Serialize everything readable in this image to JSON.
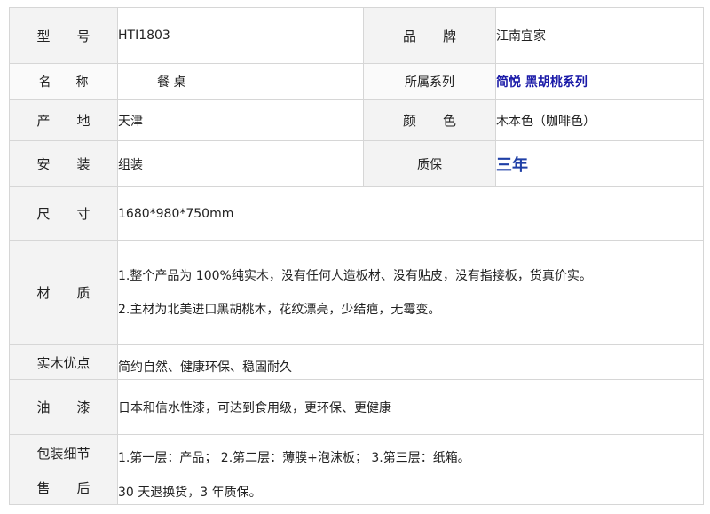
{
  "rows": {
    "model": {
      "label": "型　　号",
      "value": "HTI1803"
    },
    "brand": {
      "label": "品　　牌",
      "value": "江南宜家"
    },
    "name": {
      "label": "名　　称",
      "value": "餐 桌"
    },
    "series": {
      "label": "所属系列",
      "value": "简悦 黑胡桃系列"
    },
    "origin": {
      "label": "产　　地",
      "value": "天津"
    },
    "color": {
      "label": "颜　　色",
      "value": "木本色（咖啡色）"
    },
    "install": {
      "label": "安　　装",
      "value": "组装"
    },
    "warranty": {
      "label": "质保",
      "value": "三年"
    },
    "size": {
      "label": "尺　　寸",
      "value": "1680*980*750mm"
    },
    "material": {
      "label": "材　　质",
      "lines": [
        "1.整个产品为 100%纯实木，没有任何人造板材、没有贴皮，没有指接板，货真价实。",
        "2.主材为北美进口黑胡桃木，花纹漂亮，少结疤，无霉变。"
      ]
    },
    "advantage": {
      "label": "实木优点",
      "value": "简约自然、健康环保、稳固耐久"
    },
    "paint": {
      "label": "油　　漆",
      "value": "日本和信水性漆，可达到食用级，更环保、更健康"
    },
    "packing": {
      "label": "包装细节",
      "value": "1.第一层：产品；  2.第二层：薄膜+泡沫板；  3.第三层：纸箱。"
    },
    "after_sale": {
      "label": "售　　后",
      "value": "30 天退换货，3 年质保。"
    }
  },
  "colors": {
    "label_bg": "#f3f3f3",
    "border": "#d6d6d6",
    "series_text": "#1a1aa8",
    "warranty_text": "#1f3fa6"
  }
}
